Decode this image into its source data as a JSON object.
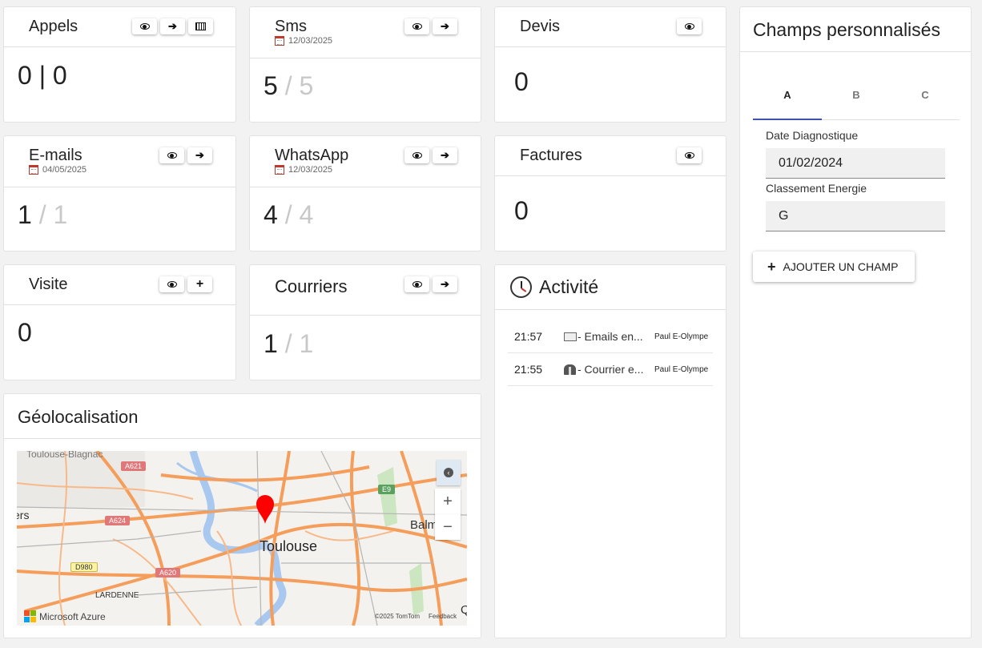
{
  "cards": {
    "appels": {
      "title": "Appels",
      "value": "0 | 0"
    },
    "sms": {
      "title": "Sms",
      "date": "12/03/2025",
      "value": "5",
      "total": "/ 5"
    },
    "devis": {
      "title": "Devis",
      "value": "0"
    },
    "emails": {
      "title": "E-mails",
      "date": "04/05/2025",
      "value": "1",
      "total": "/ 1"
    },
    "whatsapp": {
      "title": "WhatsApp",
      "date": "12/03/2025",
      "value": "4",
      "total": "/ 4"
    },
    "factures": {
      "title": "Factures",
      "value": "0"
    },
    "visite": {
      "title": "Visite",
      "value": "0"
    },
    "courriers": {
      "title": "Courriers",
      "value": "1",
      "total": "/ 1"
    }
  },
  "icons": {
    "view": "eye-icon",
    "open": "arrow-right-icon",
    "dial": "keyboard-icon",
    "add": "plus-icon",
    "date": "calendar-icon",
    "clock": "clock-icon"
  },
  "activite": {
    "title": "Activité",
    "rows": [
      {
        "time": "21:57",
        "text": "- Emails en...",
        "user": "Paul E-Olympe",
        "icon": "email-icon"
      },
      {
        "time": "21:55",
        "text": "- Courrier e...",
        "user": "Paul E-Olympe",
        "icon": "mailbox-icon"
      }
    ]
  },
  "champs": {
    "title": "Champs personnalisés",
    "tabs": [
      "A",
      "B",
      "C"
    ],
    "fields": [
      {
        "label": "Date Diagnostique",
        "value": "01/02/2024"
      },
      {
        "label": "Classement Energie",
        "value": "G"
      }
    ],
    "add_label": "AJOUTER UN CHAMP"
  },
  "geo": {
    "title": "Géolocalisation",
    "map": {
      "city": "Toulouse",
      "places": [
        "Toulouse-Blagnac",
        "ers",
        "Balm",
        "LARDENNE",
        "Q"
      ],
      "roads": [
        "A621",
        "A624",
        "A620",
        "D980",
        "E9"
      ],
      "brand": "Microsoft Azure",
      "copyright": "©2025 TomTom",
      "feedback": "Feedback",
      "zoom_in": "+",
      "zoom_out": "−"
    }
  },
  "colors": {
    "accent": "#3f51b5",
    "pin": "#ff0000",
    "road": "#f59d5a",
    "water": "#a8c8f0"
  }
}
